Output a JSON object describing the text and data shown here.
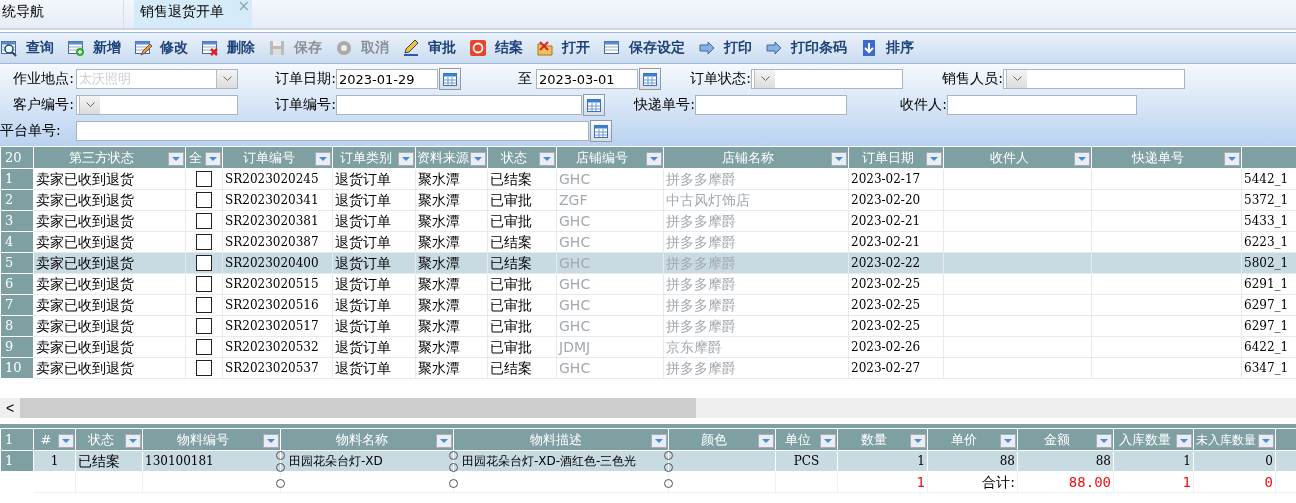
{
  "tabs": [
    {
      "label": "统导航",
      "selected": false
    },
    {
      "label": "销售退货开单",
      "selected": true,
      "close_glyph": "×"
    }
  ],
  "toolbar": [
    {
      "label": "查询",
      "disabled": false
    },
    {
      "label": "新增",
      "disabled": false
    },
    {
      "label": "修改",
      "disabled": false
    },
    {
      "label": "删除",
      "disabled": false
    },
    {
      "label": "保存",
      "disabled": true
    },
    {
      "label": "取消",
      "disabled": true
    },
    {
      "label": "审批",
      "disabled": false
    },
    {
      "label": "结案",
      "disabled": false
    },
    {
      "label": "打开",
      "disabled": false
    },
    {
      "label": "保存设定",
      "disabled": false
    },
    {
      "label": "打印",
      "disabled": false
    },
    {
      "label": "打印条码",
      "disabled": false
    },
    {
      "label": "排序",
      "disabled": false
    }
  ],
  "filters": {
    "rows": [
      [
        {
          "label": "作业地点:",
          "kind": "select",
          "value": "太沃照明",
          "disabled": true
        },
        {
          "label": "订单日期:",
          "kind": "daterange",
          "value": "2023-01-29",
          "to_label": "至",
          "to_value": "2023-03-01"
        },
        {
          "label": "订单状态:",
          "kind": "select"
        },
        {
          "label": "销售人员:",
          "kind": "select"
        }
      ],
      [
        {
          "label": "客户编号:",
          "kind": "select"
        },
        {
          "label": "订单编号:",
          "kind": "lookup"
        },
        {
          "label": "快递单号:",
          "kind": "text"
        },
        {
          "label": "收件人:",
          "kind": "text"
        }
      ],
      [
        {
          "label": "平台单号:",
          "kind": "lookup"
        }
      ]
    ]
  },
  "orders": {
    "count": "20",
    "columns": [
      "第三方状态",
      "全",
      "订单编号",
      "订单类别",
      "资料来源",
      "状态",
      "店铺编号",
      "店铺名称",
      "订单日期",
      "收件人",
      "快递单号"
    ],
    "rows": [
      {
        "no": "1",
        "third_party_status": "卖家已收到退货",
        "checked": false,
        "order_no": "SR2023020245",
        "order_type": "退货订单",
        "source": "聚水潭",
        "status": "已结案",
        "shop_code": "GHC",
        "shop_name": "拼多多摩爵",
        "order_date": "2023-02-17",
        "column_12": "5442_1",
        "selected": false
      },
      {
        "no": "2",
        "third_party_status": "卖家已收到退货",
        "checked": false,
        "order_no": "SR2023020341",
        "order_type": "退货订单",
        "source": "聚水潭",
        "status": "已审批",
        "shop_code": "ZGF",
        "shop_name": "中古风灯饰店",
        "order_date": "2023-02-20",
        "column_12": "5372_1",
        "selected": false
      },
      {
        "no": "3",
        "third_party_status": "卖家已收到退货",
        "checked": false,
        "order_no": "SR2023020381",
        "order_type": "退货订单",
        "source": "聚水潭",
        "status": "已审批",
        "shop_code": "GHC",
        "shop_name": "拼多多摩爵",
        "order_date": "2023-02-21",
        "column_12": "5433_1",
        "selected": false
      },
      {
        "no": "4",
        "third_party_status": "卖家已收到退货",
        "checked": false,
        "order_no": "SR2023020387",
        "order_type": "退货订单",
        "source": "聚水潭",
        "status": "已结案",
        "shop_code": "GHC",
        "shop_name": "拼多多摩爵",
        "order_date": "2023-02-21",
        "column_12": "6223_1",
        "selected": false
      },
      {
        "no": "5",
        "third_party_status": "卖家已收到退货",
        "checked": false,
        "order_no": "SR2023020400",
        "order_type": "退货订单",
        "source": "聚水潭",
        "status": "已结案",
        "shop_code": "GHC",
        "shop_name": "拼多多摩爵",
        "order_date": "2023-02-22",
        "column_12": "5802_1",
        "selected": true
      },
      {
        "no": "6",
        "third_party_status": "卖家已收到退货",
        "checked": false,
        "order_no": "SR2023020515",
        "order_type": "退货订单",
        "source": "聚水潭",
        "status": "已审批",
        "shop_code": "GHC",
        "shop_name": "拼多多摩爵",
        "order_date": "2023-02-25",
        "column_12": "6291_1",
        "selected": false
      },
      {
        "no": "7",
        "third_party_status": "卖家已收到退货",
        "checked": false,
        "order_no": "SR2023020516",
        "order_type": "退货订单",
        "source": "聚水潭",
        "status": "已审批",
        "shop_code": "GHC",
        "shop_name": "拼多多摩爵",
        "order_date": "2023-02-25",
        "column_12": "6297_1",
        "selected": false
      },
      {
        "no": "8",
        "third_party_status": "卖家已收到退货",
        "checked": false,
        "order_no": "SR2023020517",
        "order_type": "退货订单",
        "source": "聚水潭",
        "status": "已审批",
        "shop_code": "GHC",
        "shop_name": "拼多多摩爵",
        "order_date": "2023-02-25",
        "column_12": "6297_1",
        "selected": false
      },
      {
        "no": "9",
        "third_party_status": "卖家已收到退货",
        "checked": false,
        "order_no": "SR2023020532",
        "order_type": "退货订单",
        "source": "聚水潭",
        "status": "已审批",
        "shop_code": "JDMJ",
        "shop_name": "京东摩爵",
        "order_date": "2023-02-26",
        "column_12": "6422_1",
        "selected": false
      },
      {
        "no": "10",
        "third_party_status": "卖家已收到退货",
        "checked": false,
        "order_no": "SR2023020537",
        "order_type": "退货订单",
        "source": "聚水潭",
        "status": "已结案",
        "shop_code": "GHC",
        "shop_name": "拼多多摩爵",
        "order_date": "2023-02-27",
        "column_12": "6347_1",
        "selected": false
      }
    ]
  },
  "scrollbar_left_glyph": "<",
  "items": {
    "count": "1",
    "columns": [
      "#",
      "状态",
      "物料编号",
      "物料名称",
      "物料描述",
      "颜色",
      "单位",
      "数量",
      "单价",
      "金额",
      "入库数量",
      "未入库数量"
    ],
    "rows": [
      {
        "no": "1",
        "index": "1",
        "status": "已结案",
        "material_no": "130100181",
        "material_name": "田园花朵台灯-XD",
        "description": "田园花朵台灯-XD-酒红色-三色光",
        "unit": "PCS",
        "quantity": "1",
        "unit_price": "88",
        "amount": "88",
        "received": "1",
        "not_received": "0"
      }
    ],
    "totals": {
      "quantity": "1",
      "label": "合计:",
      "amount": "88.00",
      "received": "1",
      "not_received": "0"
    }
  }
}
